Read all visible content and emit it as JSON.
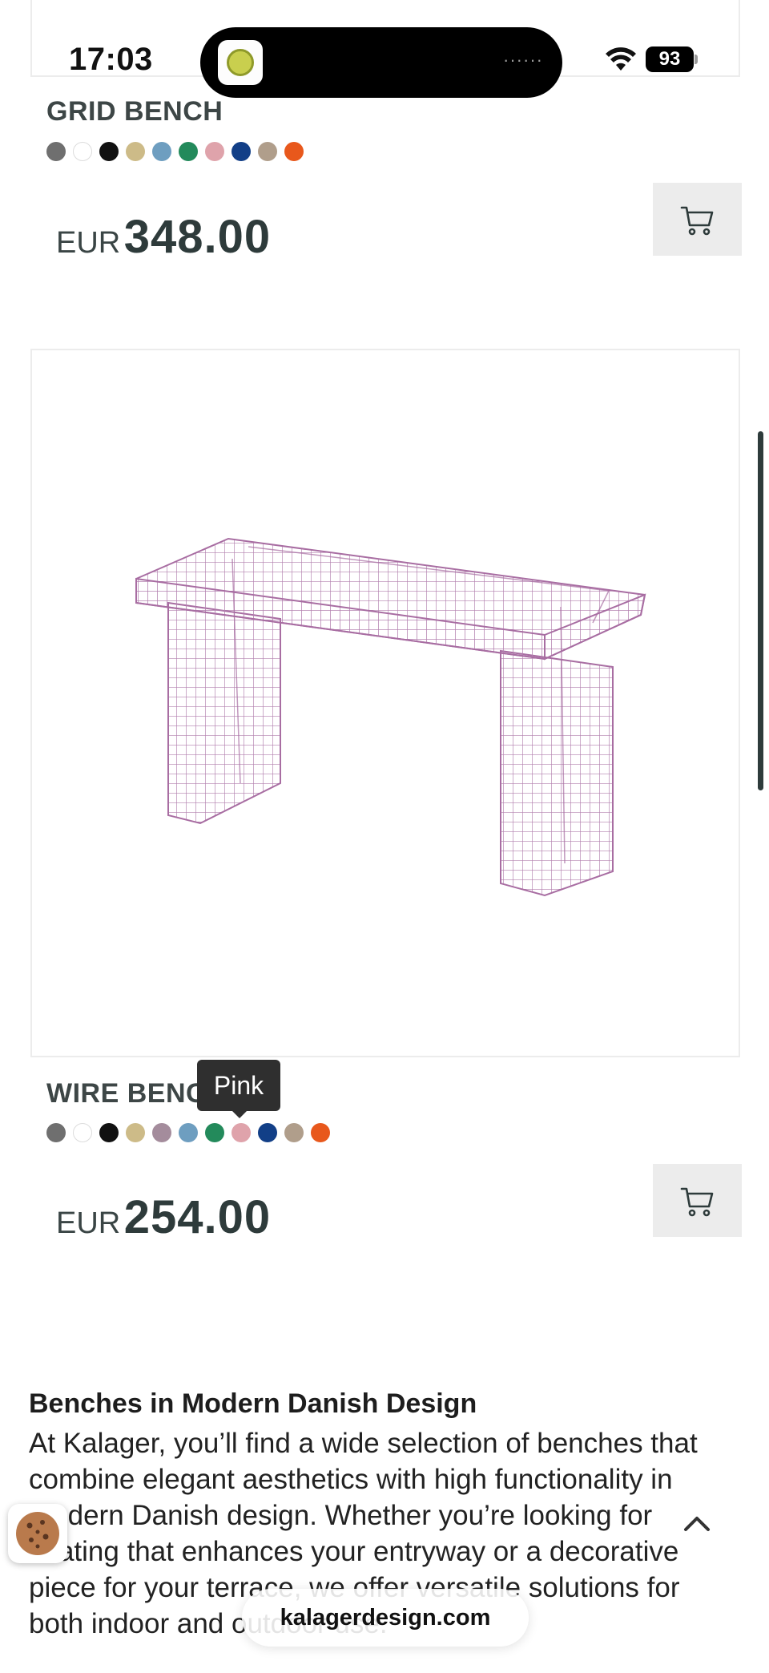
{
  "status_bar": {
    "time": "17:03",
    "battery": "93",
    "dots": "······",
    "icons": [
      "wifi-icon",
      "battery-icon"
    ]
  },
  "products": [
    {
      "name": "GRID BENCH",
      "currency": "EUR",
      "price": "348.00",
      "swatch_colors": [
        "#6f6f6f",
        "#ffffff",
        "#111111",
        "#cdbb88",
        "#6e9ec0",
        "#238a5b",
        "#dfa3ab",
        "#123f87",
        "#b09e8b",
        "#e8581c"
      ],
      "cart_icon": "cart-icon"
    },
    {
      "name": "WIRE BENCH",
      "currency": "EUR",
      "price": "254.00",
      "swatch_colors": [
        "#6f6f6f",
        "#ffffff",
        "#111111",
        "#cdbb88",
        "#a48c9c",
        "#6e9ec0",
        "#238a5b",
        "#dfa3ab",
        "#123f87",
        "#b09e8b",
        "#e8581c"
      ],
      "selected_color": "Pink",
      "cart_icon": "cart-icon"
    }
  ],
  "tooltip": "Pink",
  "description": {
    "title": "Benches in Modern Danish Design",
    "body": "At Kalager, you’ll find a wide selection of benches that combine elegant aesthetics with high functionality in modern Danish design. Whether you’re looking for seating that enhances your entryway or a decorative piece for your terrace, we offer versatile solutions for both indoor and outdoor use."
  },
  "browser": {
    "url": "kalagerdesign.com"
  },
  "colors": {
    "accent_dark": "#2e3b3b",
    "button_bg": "#ececec",
    "wire_color": "#b27fae"
  }
}
